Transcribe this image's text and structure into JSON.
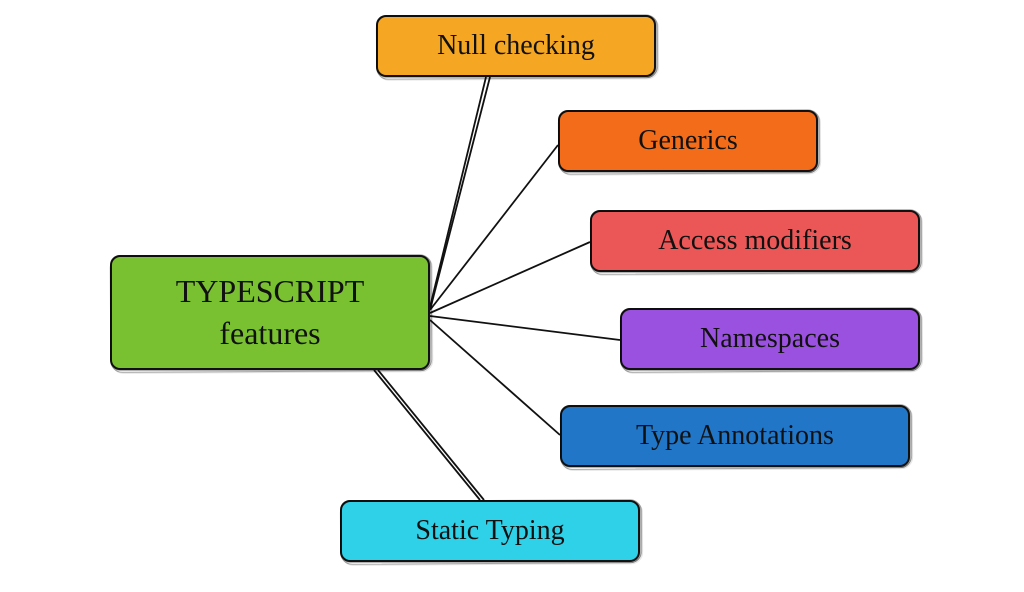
{
  "center": {
    "label": "TYPESCRIPT\nfeatures",
    "color": "#7AC132"
  },
  "features": [
    {
      "label": "Null checking",
      "color": "#F5A623"
    },
    {
      "label": "Generics",
      "color": "#F26C1A"
    },
    {
      "label": "Access modifiers",
      "color": "#EB5757"
    },
    {
      "label": "Namespaces",
      "color": "#9B51E0"
    },
    {
      "label": "Type Annotations",
      "color": "#2176C7"
    },
    {
      "label": "Static Typing",
      "color": "#2FD1E8"
    }
  ]
}
